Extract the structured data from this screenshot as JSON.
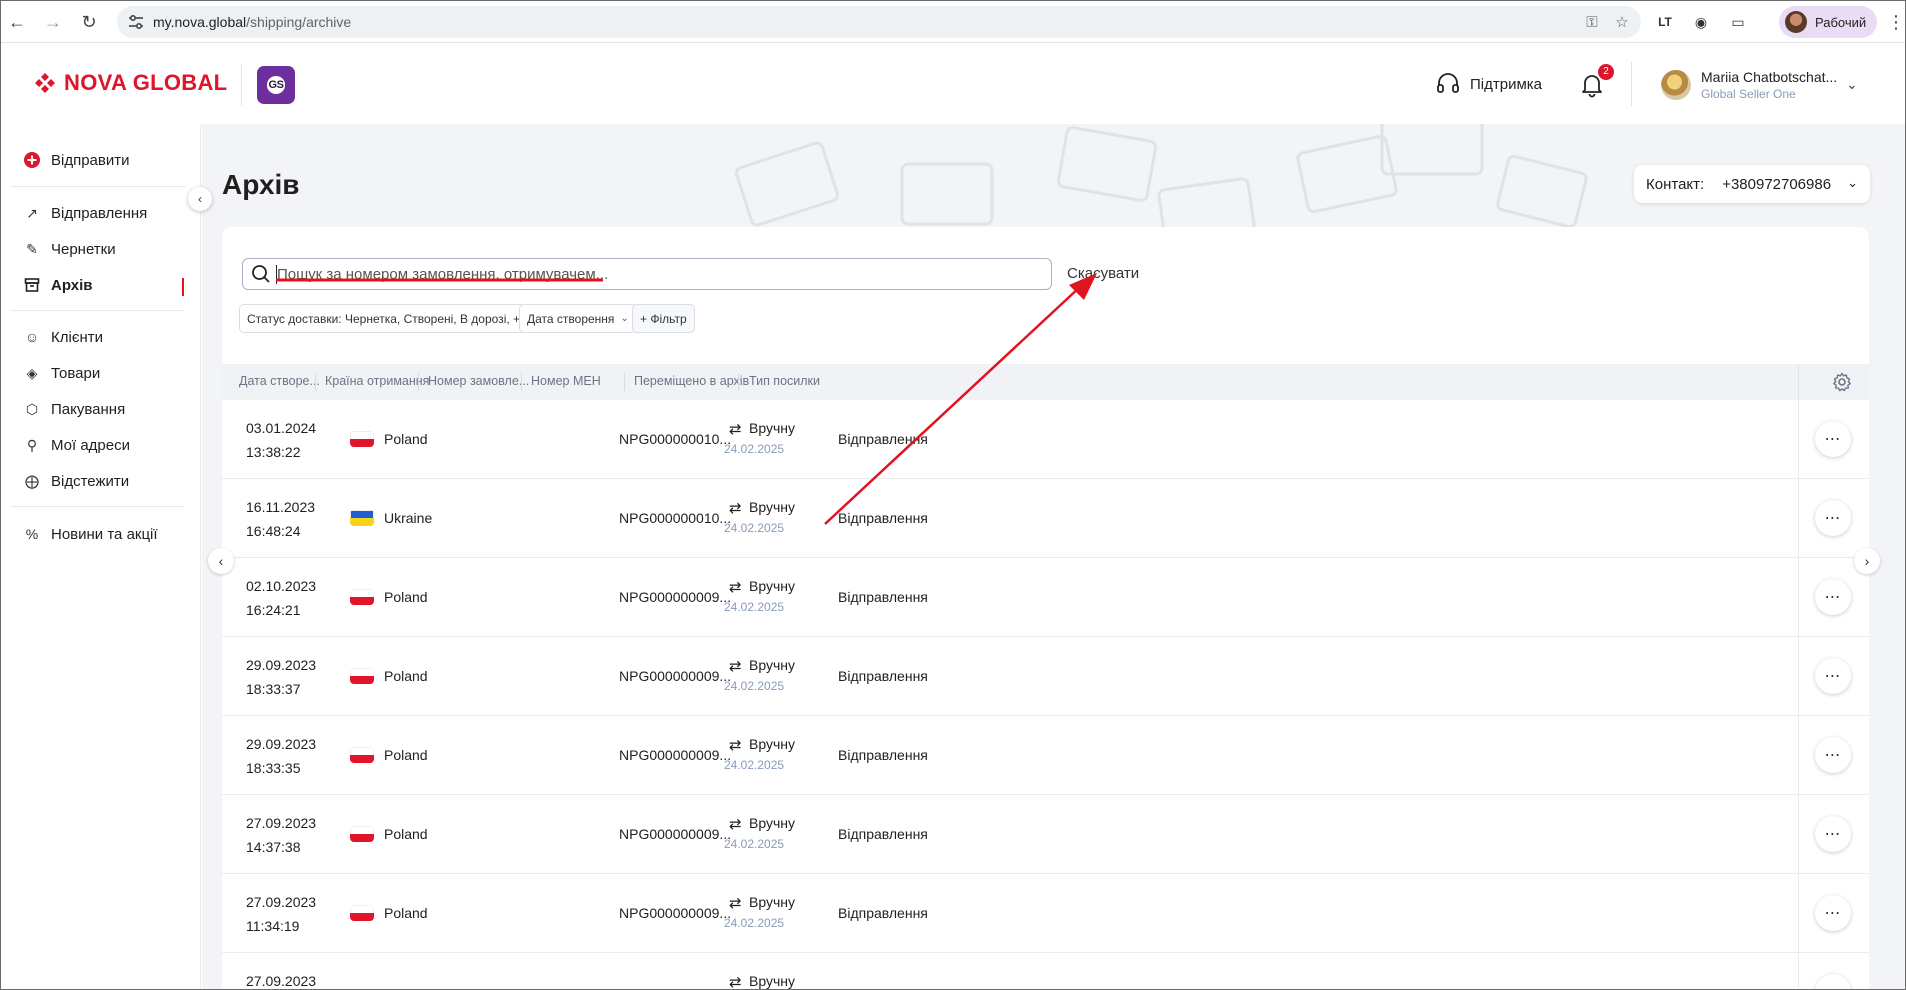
{
  "browser": {
    "url_host": "my.nova.global",
    "url_path": "/shipping/archive",
    "profile_label": "Рабочий"
  },
  "header": {
    "brand": "NOVA GLOBAL",
    "badge": "GS",
    "support_label": "Підтримка",
    "notifications_count": "2",
    "user_name": "Mariia Chatbotschat...",
    "user_sub": "Global Seller One"
  },
  "sidebar": {
    "send_label": "Відправити",
    "items": [
      {
        "label": "Відправлення",
        "icon": "arrow-up-right-icon"
      },
      {
        "label": "Чернетки",
        "icon": "pencil-icon"
      },
      {
        "label": "Архів",
        "icon": "archive-icon"
      },
      {
        "label": "Клієнти",
        "icon": "users-icon"
      },
      {
        "label": "Товари",
        "icon": "tag-icon"
      },
      {
        "label": "Пакування",
        "icon": "box-icon"
      },
      {
        "label": "Мої адреси",
        "icon": "location-icon"
      },
      {
        "label": "Відстежити",
        "icon": "target-icon"
      },
      {
        "label": "Новини та акції",
        "icon": "percent-icon"
      }
    ]
  },
  "page": {
    "title": "Архів",
    "contact_label": "Контакт:",
    "contact_value": "+380972706986"
  },
  "search": {
    "placeholder": "Пошук за номером замовлення, отримувачем...",
    "cancel_label": "Скасувати"
  },
  "filters": {
    "status": "Статус доставки: Чернетка, Створені, В дорозі, +3",
    "created": "Дата створення",
    "add_filter": "+ Фільтр"
  },
  "table": {
    "columns": [
      "Дата створе...",
      "Країна отримання",
      "Номер замовле...",
      "Номер МЕН",
      "Переміщено в архів",
      "Тип посилки"
    ],
    "rows": [
      {
        "date": "03.01.2024",
        "time": "13:38:22",
        "country": "Poland",
        "flag": "pl",
        "meh": "NPG000000010...",
        "moved": "Вручну",
        "moved_date": "24.02.2025",
        "type": "Відправлення"
      },
      {
        "date": "16.11.2023",
        "time": "16:48:24",
        "country": "Ukraine",
        "flag": "ua",
        "meh": "NPG000000010...",
        "moved": "Вручну",
        "moved_date": "24.02.2025",
        "type": "Відправлення"
      },
      {
        "date": "02.10.2023",
        "time": "16:24:21",
        "country": "Poland",
        "flag": "pl",
        "meh": "NPG000000009...",
        "moved": "Вручну",
        "moved_date": "24.02.2025",
        "type": "Відправлення"
      },
      {
        "date": "29.09.2023",
        "time": "18:33:37",
        "country": "Poland",
        "flag": "pl",
        "meh": "NPG000000009...",
        "moved": "Вручну",
        "moved_date": "24.02.2025",
        "type": "Відправлення"
      },
      {
        "date": "29.09.2023",
        "time": "18:33:35",
        "country": "Poland",
        "flag": "pl",
        "meh": "NPG000000009...",
        "moved": "Вручну",
        "moved_date": "24.02.2025",
        "type": "Відправлення"
      },
      {
        "date": "27.09.2023",
        "time": "14:37:38",
        "country": "Poland",
        "flag": "pl",
        "meh": "NPG000000009...",
        "moved": "Вручну",
        "moved_date": "24.02.2025",
        "type": "Відправлення"
      },
      {
        "date": "27.09.2023",
        "time": "11:34:19",
        "country": "Poland",
        "flag": "pl",
        "meh": "NPG000000009...",
        "moved": "Вручну",
        "moved_date": "24.02.2025",
        "type": "Відправлення"
      },
      {
        "date": "27.09.2023",
        "time": "",
        "country": "",
        "flag": "",
        "meh": "",
        "moved": "Вручну",
        "moved_date": "",
        "type": ""
      }
    ]
  },
  "colors": {
    "brand_red": "#e0142b",
    "annotation_red": "#e0141e",
    "gs_purple": "#6d2f9e"
  }
}
